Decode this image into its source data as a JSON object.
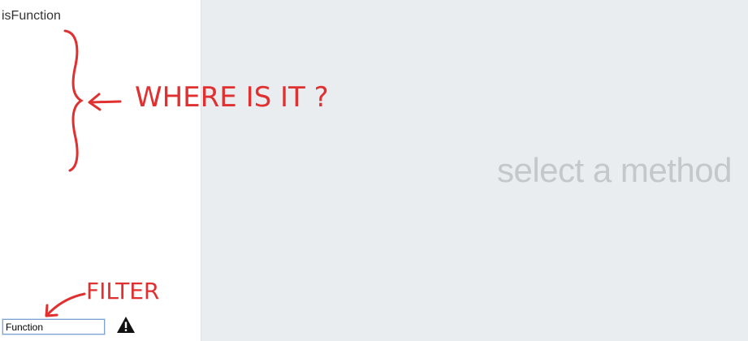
{
  "sidebar": {
    "methods": [
      {
        "label": "isFunction"
      }
    ],
    "filter": {
      "value": "Function"
    },
    "warning_icon": "warning-triangle-icon"
  },
  "main": {
    "placeholder": "select a method"
  },
  "annotations": {
    "where_note": "WHERE IS IT ?",
    "filter_note": "FILTER",
    "color": "#e03030"
  }
}
